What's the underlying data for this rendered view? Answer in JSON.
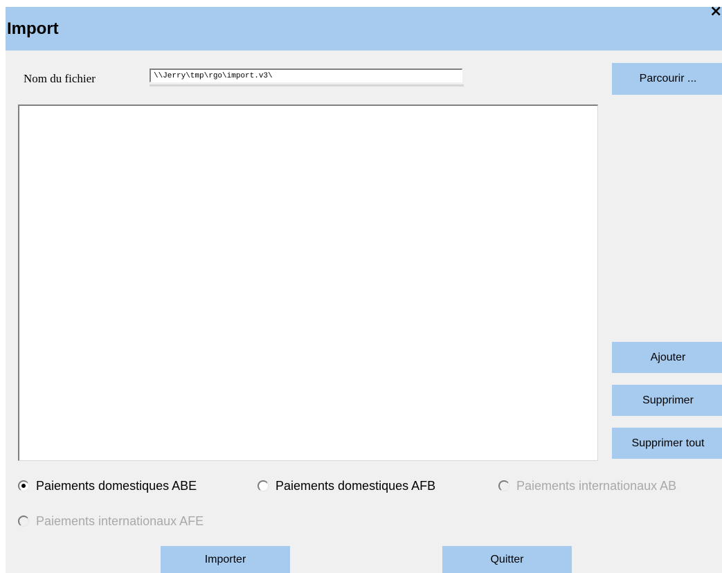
{
  "window": {
    "title": "Import",
    "close_label": "×"
  },
  "file": {
    "label": "Nom du fichier",
    "value": "\\\\Jerry\\tmp\\rgo\\import.v3\\"
  },
  "buttons": {
    "browse": "Parcourir ...",
    "add": "Ajouter",
    "delete": "Supprimer",
    "delete_all": "Supprimer tout",
    "import": "Importer",
    "quit": "Quitter"
  },
  "file_list": [],
  "radio_options": [
    {
      "label": "Paiements domestiques ABE",
      "checked": true,
      "disabled": false
    },
    {
      "label": "Paiements domestiques AFB",
      "checked": false,
      "disabled": false
    },
    {
      "label": "Paiements internationaux AB",
      "checked": false,
      "disabled": true
    },
    {
      "label": "Paiements internationaux AFE",
      "checked": false,
      "disabled": true
    }
  ],
  "colors": {
    "accent": "#a7cbef",
    "background": "#f0f0f0",
    "disabled_text": "#a9a9a9"
  }
}
